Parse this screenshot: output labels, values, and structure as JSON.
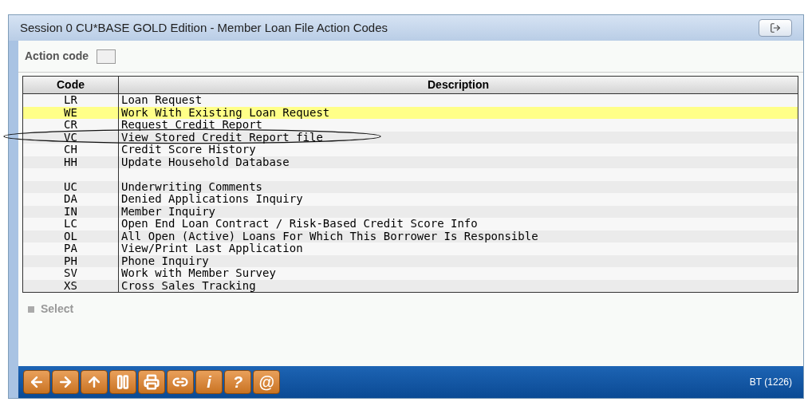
{
  "window": {
    "title": "Session 0 CU*BASE GOLD Edition - Member Loan File Action Codes"
  },
  "action_code": {
    "label": "Action code"
  },
  "table": {
    "columns": [
      "Code",
      "Description"
    ],
    "rows": [
      {
        "code": "LR",
        "description": "Loan Request",
        "selected": false
      },
      {
        "code": "WE",
        "description": "Work With Existing Loan Request",
        "selected": true
      },
      {
        "code": "CR",
        "description": "Request Credit Report",
        "selected": false
      },
      {
        "code": "VC",
        "description": "View Stored Credit Report file",
        "selected": false
      },
      {
        "code": "CH",
        "description": "Credit Score History",
        "selected": false
      },
      {
        "code": "HH",
        "description": "Update Household Database",
        "selected": false
      },
      {
        "selected": false
      },
      {
        "code": "UC",
        "description": "Underwriting Comments",
        "selected": false
      },
      {
        "code": "DA",
        "description": "Denied Applications Inquiry",
        "selected": false
      },
      {
        "code": "IN",
        "description": "Member Inquiry",
        "selected": false
      },
      {
        "code": "LC",
        "description": "Open End Loan Contract / Risk-Based Credit Score Info",
        "selected": false
      },
      {
        "code": "OL",
        "description": "All Open (Active) Loans For Which This Borrower Is Responsible",
        "selected": false
      },
      {
        "code": "PA",
        "description": "View/Print Last Application",
        "selected": false
      },
      {
        "code": "PH",
        "description": "Phone Inquiry",
        "selected": false
      },
      {
        "code": "SV",
        "description": "Work with Member Survey",
        "selected": false
      },
      {
        "code": "XS",
        "description": "Cross Sales Tracking",
        "selected": false
      }
    ]
  },
  "actions": [
    {
      "label": "Select",
      "disabled": true
    }
  ],
  "toolbar": {
    "glyph_buttons": [
      "i",
      "?",
      "@"
    ]
  },
  "status": "BT (1226)"
}
